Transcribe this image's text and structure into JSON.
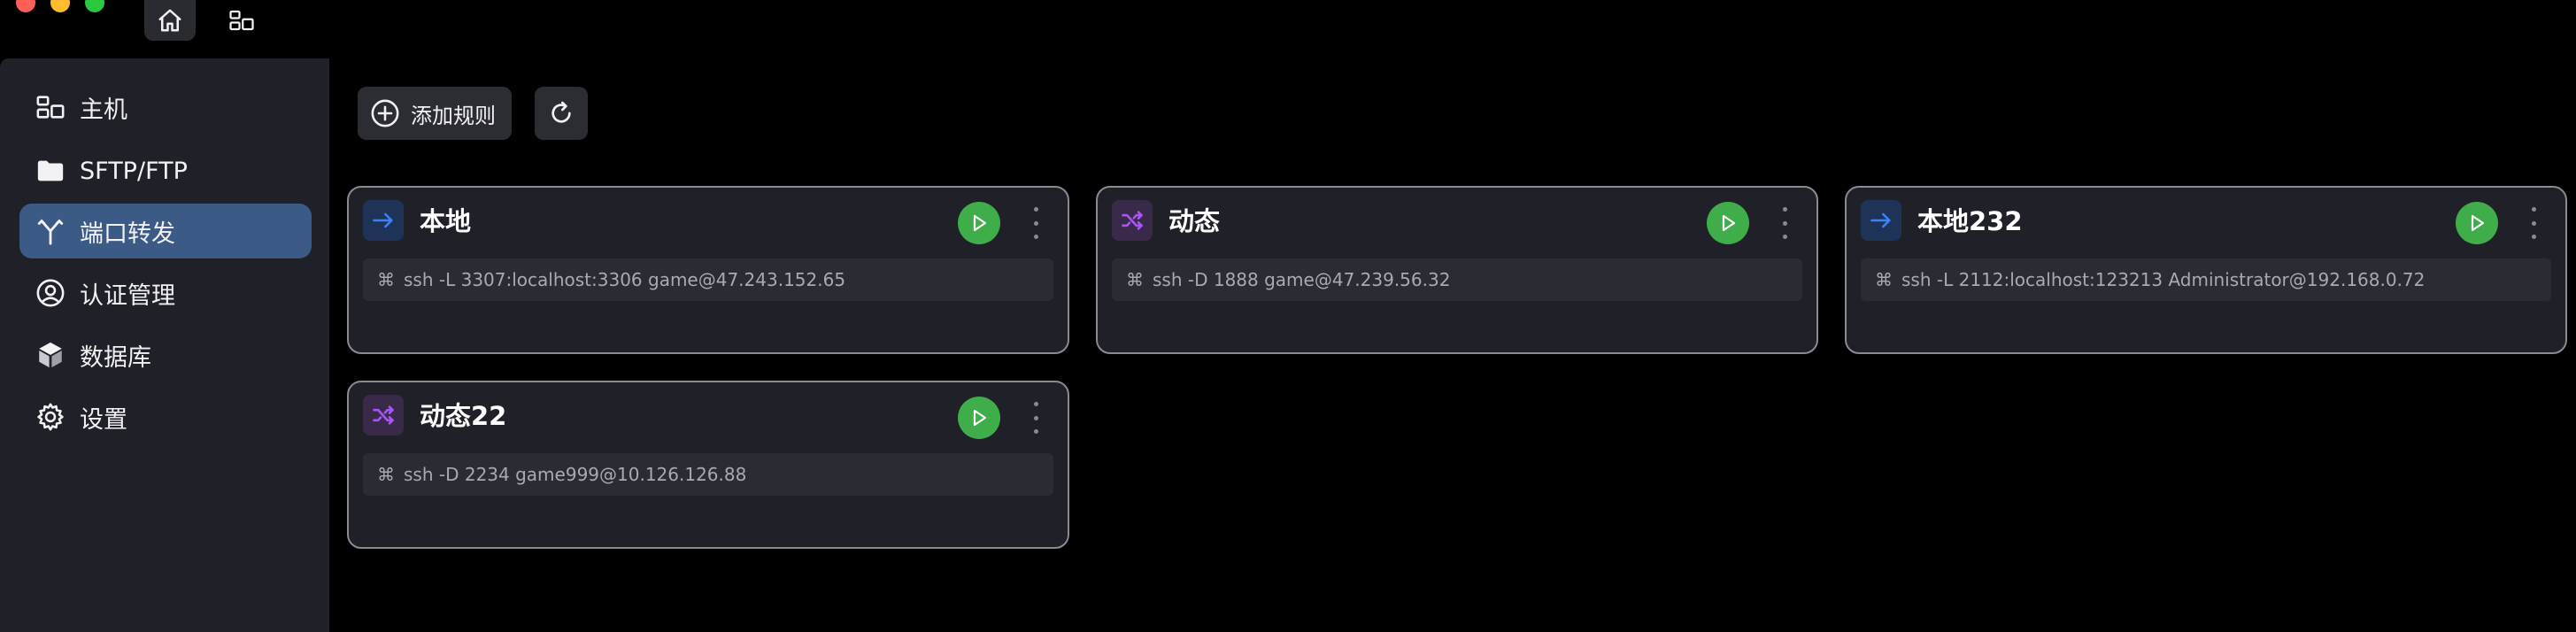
{
  "colors": {
    "accent": "#3b5a86",
    "play": "#3fae4a",
    "local_icon": "#3b82f6",
    "dynamic_icon": "#a855f7"
  },
  "titlebar": {
    "tabs": [
      {
        "icon": "home-icon"
      },
      {
        "icon": "hosts-icon"
      }
    ]
  },
  "sidebar": {
    "items": [
      {
        "label": "主机",
        "icon": "hosts-icon"
      },
      {
        "label": "SFTP/FTP",
        "icon": "folder-icon"
      },
      {
        "label": "端口转发",
        "icon": "port-forward-icon",
        "active": true
      },
      {
        "label": "认证管理",
        "icon": "auth-icon"
      },
      {
        "label": "数据库",
        "icon": "database-icon"
      },
      {
        "label": "设置",
        "icon": "gear-icon"
      }
    ]
  },
  "toolbar": {
    "add_label": "添加规则"
  },
  "rules": [
    {
      "type": "local",
      "title": "本地",
      "cmd_glyph": "⌘",
      "command": "ssh -L 3307:localhost:3306 game@47.243.152.65"
    },
    {
      "type": "dynamic",
      "title": "动态",
      "cmd_glyph": "⌘",
      "command": "ssh -D 1888 game@47.239.56.32"
    },
    {
      "type": "local",
      "title": "本地232",
      "cmd_glyph": "⌘",
      "command": "ssh -L 2112:localhost:123213 Administrator@192.168.0.72"
    },
    {
      "type": "dynamic",
      "title": "动态22",
      "cmd_glyph": "⌘",
      "command": "ssh -D 2234 game999@10.126.126.88"
    }
  ]
}
